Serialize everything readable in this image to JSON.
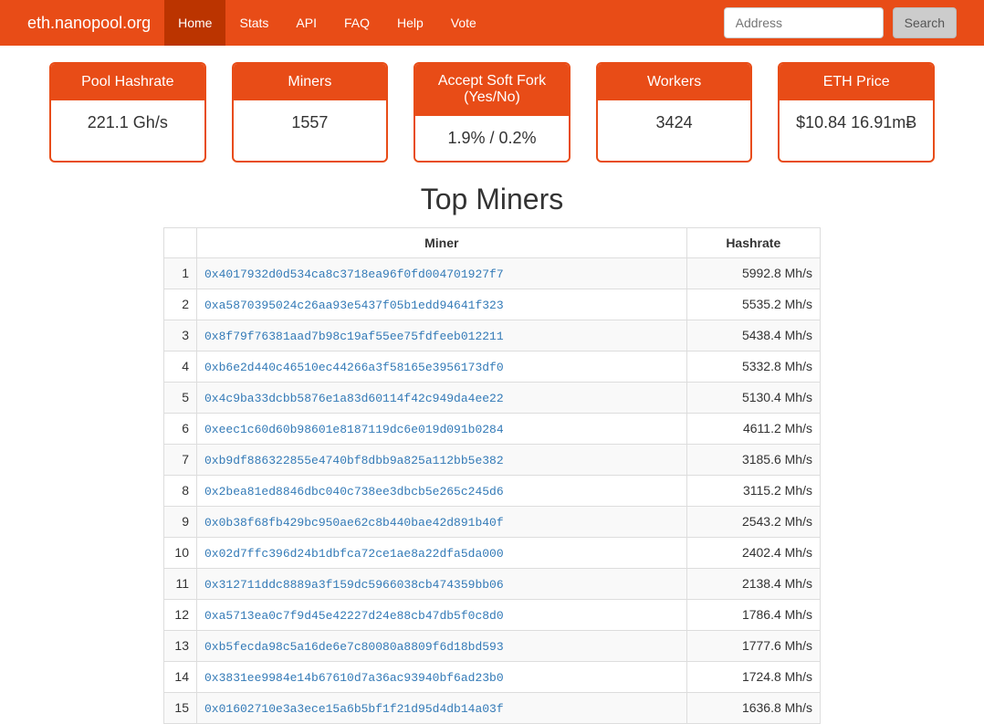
{
  "brand": "eth.nanopool.org",
  "nav": {
    "items": [
      {
        "label": "Home",
        "active": true
      },
      {
        "label": "Stats",
        "active": false
      },
      {
        "label": "API",
        "active": false
      },
      {
        "label": "FAQ",
        "active": false
      },
      {
        "label": "Help",
        "active": false
      },
      {
        "label": "Vote",
        "active": false
      }
    ]
  },
  "search": {
    "placeholder": "Address",
    "btn": "Search"
  },
  "stats": {
    "items": [
      {
        "title": "Pool Hashrate",
        "value": "221.1 Gh/s"
      },
      {
        "title": "Miners",
        "value": "1557"
      },
      {
        "title": "Accept Soft Fork (Yes/No)",
        "value": "1.9% / 0.2%"
      },
      {
        "title": "Workers",
        "value": "3424"
      },
      {
        "title": "ETH Price",
        "value": "$10.84 16.91mɃ"
      }
    ]
  },
  "section_title": "Top Miners",
  "table": {
    "headers": {
      "rank": "",
      "miner": "Miner",
      "hashrate": "Hashrate"
    },
    "rows": [
      {
        "rank": "1",
        "miner": "0x4017932d0d534ca8c3718ea96f0fd004701927f7",
        "hashrate": "5992.8 Mh/s"
      },
      {
        "rank": "2",
        "miner": "0xa5870395024c26aa93e5437f05b1edd94641f323",
        "hashrate": "5535.2 Mh/s"
      },
      {
        "rank": "3",
        "miner": "0x8f79f76381aad7b98c19af55ee75fdfeeb012211",
        "hashrate": "5438.4 Mh/s"
      },
      {
        "rank": "4",
        "miner": "0xb6e2d440c46510ec44266a3f58165e3956173df0",
        "hashrate": "5332.8 Mh/s"
      },
      {
        "rank": "5",
        "miner": "0x4c9ba33dcbb5876e1a83d60114f42c949da4ee22",
        "hashrate": "5130.4 Mh/s"
      },
      {
        "rank": "6",
        "miner": "0xeec1c60d60b98601e8187119dc6e019d091b0284",
        "hashrate": "4611.2 Mh/s"
      },
      {
        "rank": "7",
        "miner": "0xb9df886322855e4740bf8dbb9a825a112bb5e382",
        "hashrate": "3185.6 Mh/s"
      },
      {
        "rank": "8",
        "miner": "0x2bea81ed8846dbc040c738ee3dbcb5e265c245d6",
        "hashrate": "3115.2 Mh/s"
      },
      {
        "rank": "9",
        "miner": "0x0b38f68fb429bc950ae62c8b440bae42d891b40f",
        "hashrate": "2543.2 Mh/s"
      },
      {
        "rank": "10",
        "miner": "0x02d7ffc396d24b1dbfca72ce1ae8a22dfa5da000",
        "hashrate": "2402.4 Mh/s"
      },
      {
        "rank": "11",
        "miner": "0x312711ddc8889a3f159dc5966038cb474359bb06",
        "hashrate": "2138.4 Mh/s"
      },
      {
        "rank": "12",
        "miner": "0xa5713ea0c7f9d45e42227d24e88cb47db5f0c8d0",
        "hashrate": "1786.4 Mh/s"
      },
      {
        "rank": "13",
        "miner": "0xb5fecda98c5a16de6e7c80080a8809f6d18bd593",
        "hashrate": "1777.6 Mh/s"
      },
      {
        "rank": "14",
        "miner": "0x3831ee9984e14b67610d7a36ac93940bf6ad23b0",
        "hashrate": "1724.8 Mh/s"
      },
      {
        "rank": "15",
        "miner": "0x01602710e3a3ece15a6b5bf1f21d95d4db14a03f",
        "hashrate": "1636.8 Mh/s"
      }
    ]
  }
}
